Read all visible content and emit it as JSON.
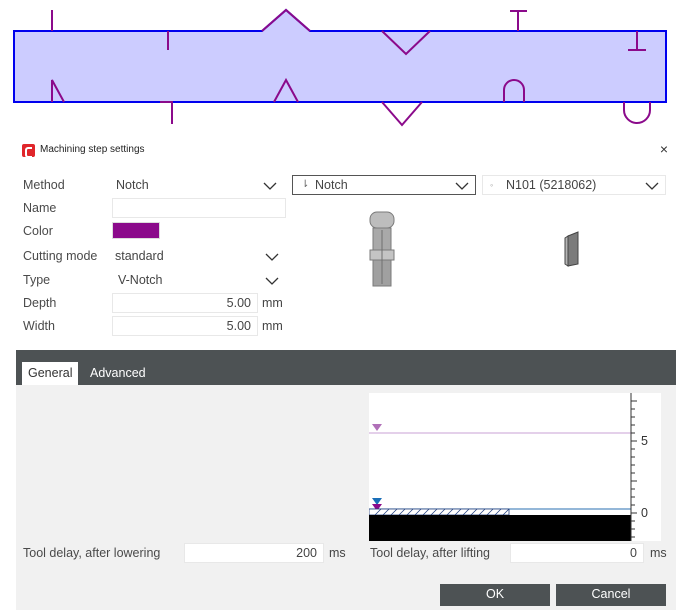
{
  "dialog": {
    "title": "Machining step settings",
    "close_glyph": "×"
  },
  "form": {
    "method_label": "Method",
    "method_value": "Notch",
    "method_tool_value": "Notch",
    "method_tool_icon": "notch-tool-icon",
    "material_value": "N101 (5218062)",
    "material_icon": "profile-icon",
    "name_label": "Name",
    "name_value": "",
    "color_label": "Color",
    "color_value": "#8b0a8b",
    "cutting_mode_label": "Cutting mode",
    "cutting_mode_value": "standard",
    "type_label": "Type",
    "type_value": "V-Notch",
    "depth_label": "Depth",
    "depth_value": "5.00",
    "depth_unit": "mm",
    "width_label": "Width",
    "width_value": "5.00",
    "width_unit": "mm"
  },
  "tabs": [
    {
      "label": "General",
      "active": true
    },
    {
      "label": "Advanced",
      "active": false
    }
  ],
  "general": {
    "tool_delay_lowering_label": "Tool delay, after lowering",
    "tool_delay_lowering_value": "200",
    "tool_delay_lowering_unit": "ms",
    "tool_delay_lifting_label": "Tool delay, after lifting",
    "tool_delay_lifting_value": "0",
    "tool_delay_lifting_unit": "ms"
  },
  "depth_graph": {
    "tick_labels": [
      "5",
      "0"
    ],
    "upper_marker_value": 5.5,
    "lower_marker_value": 0.8
  },
  "buttons": {
    "ok_label": "OK",
    "cancel_label": "Cancel"
  },
  "colors": {
    "accent_dark": "#4d5254",
    "preview_fill": "#ccccff",
    "preview_outline": "#0000ee",
    "notch_color": "#8b0a8b",
    "logo_red": "#e0262b"
  }
}
